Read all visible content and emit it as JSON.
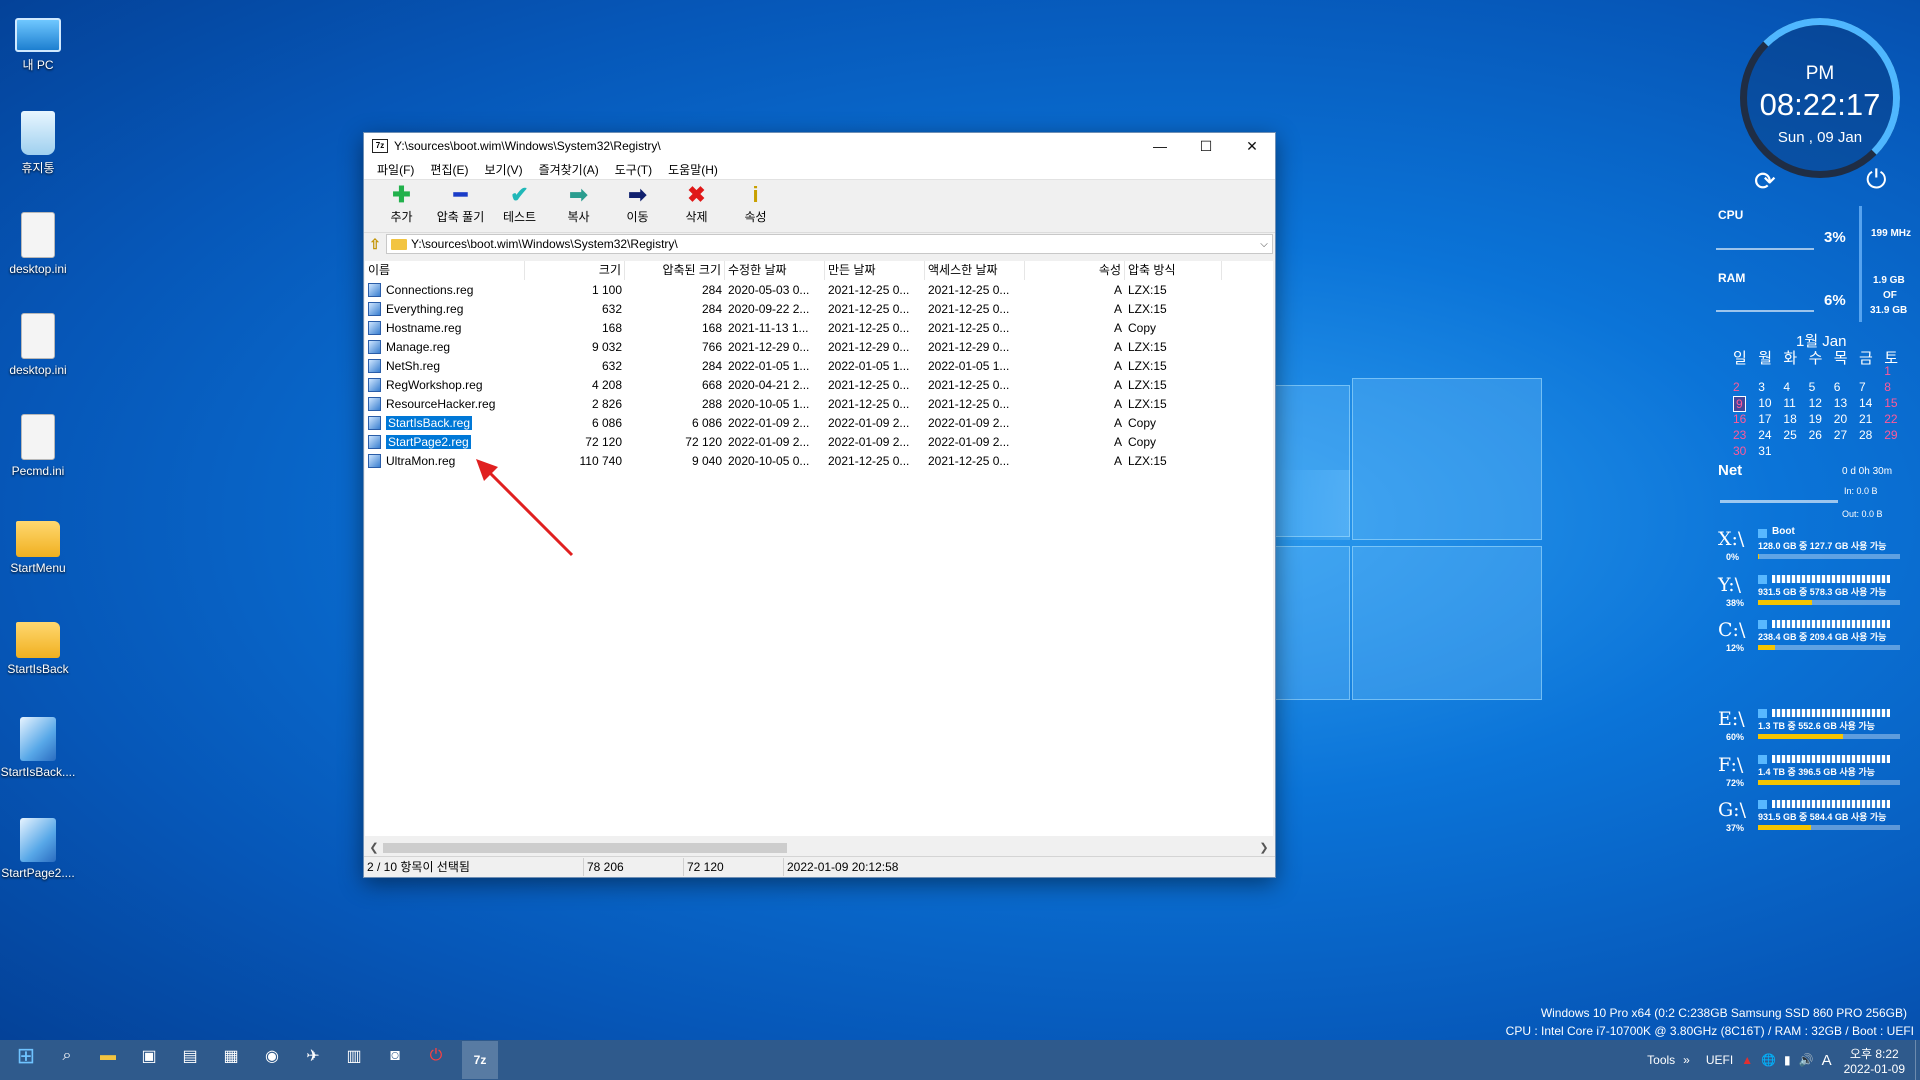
{
  "desktop": {
    "icons": [
      {
        "label": "내 PC"
      },
      {
        "label": "휴지통"
      },
      {
        "label": "desktop.ini"
      },
      {
        "label": "desktop.ini"
      },
      {
        "label": "Pecmd.ini"
      },
      {
        "label": "StartMenu"
      },
      {
        "label": "StartIsBack"
      },
      {
        "label": "StartIsBack...."
      },
      {
        "label": "StartPage2...."
      }
    ]
  },
  "window": {
    "title": "Y:\\sources\\boot.wim\\Windows\\System32\\Registry\\",
    "app_icon": "7z",
    "menu": [
      "파일(F)",
      "편집(E)",
      "보기(V)",
      "즐겨찾기(A)",
      "도구(T)",
      "도움말(H)"
    ],
    "toolbar": [
      {
        "label": "추가",
        "icon": "plus-icon",
        "glyph": "✚",
        "color": "#22b14c"
      },
      {
        "label": "압축 풀기",
        "icon": "minus-icon",
        "glyph": "━",
        "color": "#1a3cc8"
      },
      {
        "label": "테스트",
        "icon": "check-icon",
        "glyph": "✔",
        "color": "#20b8b8"
      },
      {
        "label": "복사",
        "icon": "copy-arrow-icon",
        "glyph": "➡",
        "color": "#2a9d8f"
      },
      {
        "label": "이동",
        "icon": "move-arrow-icon",
        "glyph": "➡",
        "color": "#10206e"
      },
      {
        "label": "삭제",
        "icon": "delete-x-icon",
        "glyph": "✖",
        "color": "#e01818"
      },
      {
        "label": "속성",
        "icon": "info-icon",
        "glyph": "i",
        "color": "#c8a000"
      }
    ],
    "address": "Y:\\sources\\boot.wim\\Windows\\System32\\Registry\\",
    "columns": [
      "이름",
      "크기",
      "압축된 크기",
      "수정한 날짜",
      "만든 날짜",
      "액세스한 날짜",
      "속성",
      "압축 방식"
    ],
    "files": [
      {
        "name": "Connections.reg",
        "size": "1 100",
        "csize": "284",
        "modified": "2020-05-03 0...",
        "created": "2021-12-25 0...",
        "accessed": "2021-12-25 0...",
        "attr": "A",
        "method": "LZX:15",
        "selected": false
      },
      {
        "name": "Everything.reg",
        "size": "632",
        "csize": "284",
        "modified": "2020-09-22 2...",
        "created": "2021-12-25 0...",
        "accessed": "2021-12-25 0...",
        "attr": "A",
        "method": "LZX:15",
        "selected": false
      },
      {
        "name": "Hostname.reg",
        "size": "168",
        "csize": "168",
        "modified": "2021-11-13 1...",
        "created": "2021-12-25 0...",
        "accessed": "2021-12-25 0...",
        "attr": "A",
        "method": "Copy",
        "selected": false
      },
      {
        "name": "Manage.reg",
        "size": "9 032",
        "csize": "766",
        "modified": "2021-12-29 0...",
        "created": "2021-12-29 0...",
        "accessed": "2021-12-29 0...",
        "attr": "A",
        "method": "LZX:15",
        "selected": false
      },
      {
        "name": "NetSh.reg",
        "size": "632",
        "csize": "284",
        "modified": "2022-01-05 1...",
        "created": "2022-01-05 1...",
        "accessed": "2022-01-05 1...",
        "attr": "A",
        "method": "LZX:15",
        "selected": false
      },
      {
        "name": "RegWorkshop.reg",
        "size": "4 208",
        "csize": "668",
        "modified": "2020-04-21 2...",
        "created": "2021-12-25 0...",
        "accessed": "2021-12-25 0...",
        "attr": "A",
        "method": "LZX:15",
        "selected": false
      },
      {
        "name": "ResourceHacker.reg",
        "size": "2 826",
        "csize": "288",
        "modified": "2020-10-05 1...",
        "created": "2021-12-25 0...",
        "accessed": "2021-12-25 0...",
        "attr": "A",
        "method": "LZX:15",
        "selected": false
      },
      {
        "name": "StartIsBack.reg",
        "size": "6 086",
        "csize": "6 086",
        "modified": "2022-01-09 2...",
        "created": "2022-01-09 2...",
        "accessed": "2022-01-09 2...",
        "attr": "A",
        "method": "Copy",
        "selected": true
      },
      {
        "name": "StartPage2.reg",
        "size": "72 120",
        "csize": "72 120",
        "modified": "2022-01-09 2...",
        "created": "2022-01-09 2...",
        "accessed": "2022-01-09 2...",
        "attr": "A",
        "method": "Copy",
        "selected": true
      },
      {
        "name": "UltraMon.reg",
        "size": "110 740",
        "csize": "9 040",
        "modified": "2020-10-05 0...",
        "created": "2021-12-25 0...",
        "accessed": "2021-12-25 0...",
        "attr": "A",
        "method": "LZX:15",
        "selected": false
      }
    ],
    "status": {
      "selection": "2 / 10 항목이 선택됨",
      "size": "78 206",
      "csize": "72 120",
      "date": "2022-01-09 20:12:58"
    }
  },
  "gadgets": {
    "clock": {
      "ampm": "PM",
      "time": "08:22:17",
      "date": "Sun , 09 Jan"
    },
    "cpu": {
      "label": "CPU",
      "percent": "3%",
      "freq": "199 MHz"
    },
    "ram": {
      "label": "RAM",
      "percent": "6%",
      "used": "1.9 GB",
      "of": "OF",
      "total": "31.9 GB"
    },
    "calendar": {
      "title": "1월 Jan",
      "weekdays": [
        "일",
        "월",
        "화",
        "수",
        "목",
        "금",
        "토"
      ],
      "rows": [
        [
          "",
          "",
          "",
          "",
          "",
          "",
          "1"
        ],
        [
          "2",
          "3",
          "4",
          "5",
          "6",
          "7",
          "8"
        ],
        [
          "9",
          "10",
          "11",
          "12",
          "13",
          "14",
          "15"
        ],
        [
          "16",
          "17",
          "18",
          "19",
          "20",
          "21",
          "22"
        ],
        [
          "23",
          "24",
          "25",
          "26",
          "27",
          "28",
          "29"
        ],
        [
          "30",
          "31",
          "",
          "",
          "",
          "",
          ""
        ]
      ],
      "today": "9"
    },
    "net": {
      "label": "Net",
      "uptime": "0 d 0h 30m",
      "in": "In: 0.0 B",
      "out": "Out: 0.0 B"
    },
    "drives": [
      {
        "letter": "X:\\",
        "pct": "0%",
        "name": "Boot",
        "info": "128.0 GB 중 127.7 GB 사용 가능",
        "fill": 0.003,
        "color": "#f5c400"
      },
      {
        "letter": "Y:\\",
        "pct": "38%",
        "name": "",
        "info": "931.5 GB 중 578.3 GB 사용 가능",
        "fill": 0.38,
        "color": "#f5c400"
      },
      {
        "letter": "C:\\",
        "pct": "12%",
        "name": "",
        "info": "238.4 GB 중 209.4 GB 사용 가능",
        "fill": 0.12,
        "color": "#f5c400"
      },
      {
        "letter": "E:\\",
        "pct": "60%",
        "name": "",
        "info": "1.3 TB 중     552.6 GB 사용 가능",
        "fill": 0.6,
        "color": "#f5c400"
      },
      {
        "letter": "F:\\",
        "pct": "72%",
        "name": "",
        "info": "1.4 TB 중     396.5 GB 사용 가능",
        "fill": 0.72,
        "color": "#f5c400"
      },
      {
        "letter": "G:\\",
        "pct": "37%",
        "name": "",
        "info": "931.5 GB 중 584.4 GB 사용 가능",
        "fill": 0.37,
        "color": "#f5c400"
      }
    ]
  },
  "sysinfo": {
    "line1": "Windows 10 Pro x64 (0:2 C:238GB Samsung SSD 860 PRO 256GB)",
    "line2": "CPU : Intel Core i7-10700K @ 3.80GHz (8C16T) / RAM : 32GB / Boot : UEFI"
  },
  "taskbar": {
    "icons": [
      "start-icon",
      "search-icon",
      "file-explorer-icon",
      "terminal-icon",
      "save-tool-icon",
      "chip-tool-icon",
      "edge-icon",
      "bird-app-icon",
      "registry-tool-icon",
      "camera-icon",
      "power-app-icon",
      "7zip-icon"
    ],
    "tray": {
      "tools": "Tools",
      "chevron": "»",
      "uefi": "UEFI",
      "ime": "A",
      "time": "오후 8:22",
      "date": "2022-01-09"
    }
  }
}
